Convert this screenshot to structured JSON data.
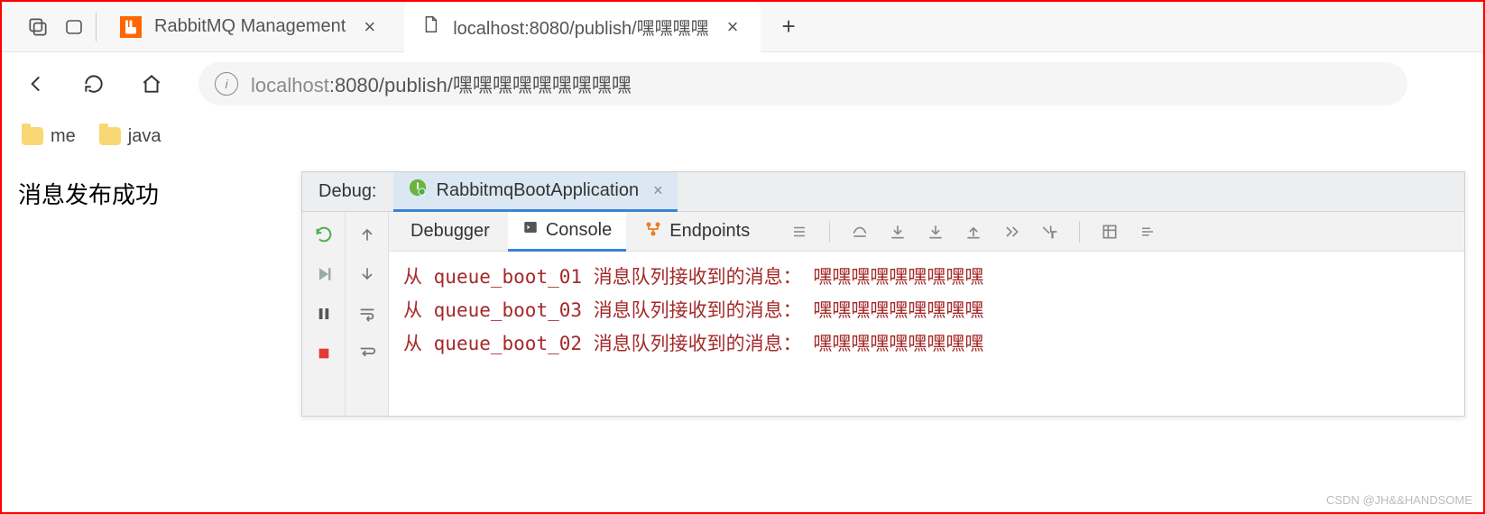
{
  "browser": {
    "tabs": [
      {
        "title": "RabbitMQ Management",
        "active": false,
        "favicon": "rabbit"
      },
      {
        "title": "localhost:8080/publish/嘿嘿嘿嘿",
        "active": true,
        "favicon": "page"
      }
    ],
    "address": {
      "host": "localhost",
      "rest": ":8080/publish/嘿嘿嘿嘿嘿嘿嘿嘿嘿"
    },
    "bookmarks": [
      {
        "label": "me"
      },
      {
        "label": "java"
      }
    ]
  },
  "page": {
    "message": "消息发布成功"
  },
  "ide": {
    "debug_label": "Debug:",
    "run_config": "RabbitmqBootApplication",
    "tabs": {
      "debugger": "Debugger",
      "console": "Console",
      "endpoints": "Endpoints"
    },
    "console_lines": [
      {
        "prefix": "从",
        "queue": "queue_boot_01",
        "label": "消息队列接收到的消息：",
        "msg": "嘿嘿嘿嘿嘿嘿嘿嘿嘿"
      },
      {
        "prefix": "从",
        "queue": "queue_boot_03",
        "label": "消息队列接收到的消息：",
        "msg": "嘿嘿嘿嘿嘿嘿嘿嘿嘿"
      },
      {
        "prefix": "从",
        "queue": "queue_boot_02",
        "label": "消息队列接收到的消息：",
        "msg": "嘿嘿嘿嘿嘿嘿嘿嘿嘿"
      }
    ]
  },
  "watermark": "CSDN @JH&&HANDSOME"
}
